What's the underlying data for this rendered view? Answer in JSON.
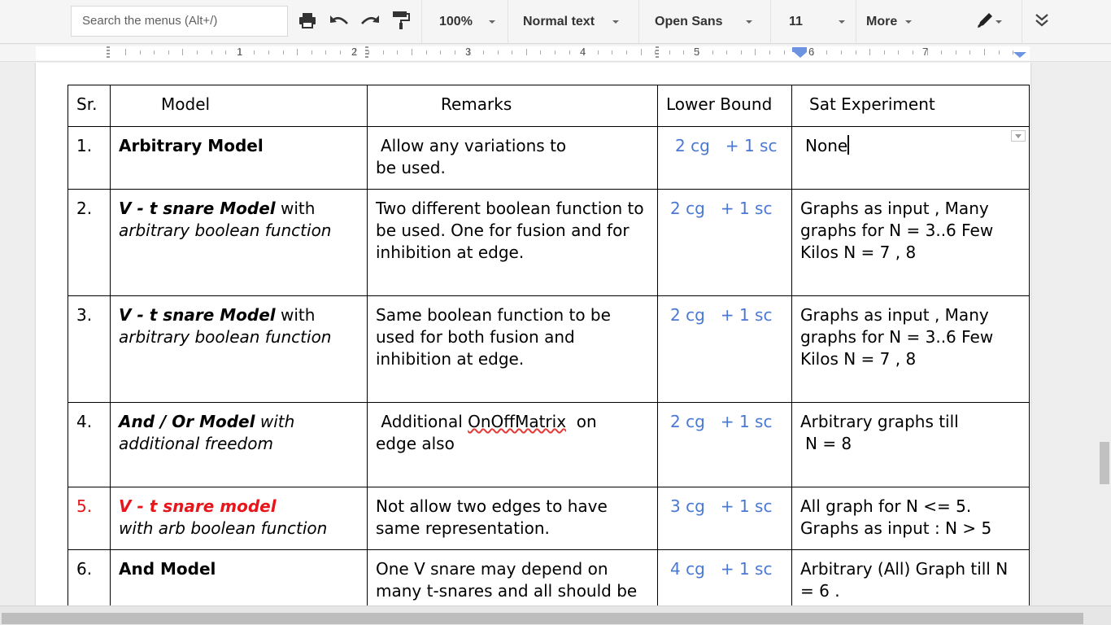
{
  "toolbar": {
    "search_placeholder": "Search the menus (Alt+/)",
    "zoom": "100%",
    "style": "Normal text",
    "font": "Open Sans",
    "size": "11",
    "more": "More"
  },
  "ruler": {
    "numbers": [
      "1",
      "2",
      "3",
      "4",
      "5",
      "6",
      "7"
    ]
  },
  "table": {
    "headers": [
      "Sr.",
      "Model",
      "Remarks",
      "Lower Bound",
      "Sat Experiment"
    ],
    "rows": [
      {
        "sr": "1.",
        "model_bold": "Arbitrary Model",
        "remarks_1": "Allow any variations to",
        "remarks_2": "be used.",
        "cg": "2 cg",
        "sc": "+ 1 sc",
        "sat": "None"
      },
      {
        "sr": "2.",
        "model_bold": "V - t snare Model",
        "model_with": " with",
        "model_2": "arbitrary boolean function",
        "remarks": "Two different boolean function to be used. One for fusion and for inhibition at edge.",
        "cg": "2 cg",
        "sc": "+ 1 sc",
        "sat": "Graphs as input , Many graphs for N = 3..6 Few Kilos N = 7 , 8"
      },
      {
        "sr": "3.",
        "model_bold": "V - t snare Model",
        "model_with": " with",
        "model_2": "arbitrary boolean function",
        "remarks": "Same boolean function  to be used for both fusion and inhibition at edge.",
        "cg": "2 cg",
        "sc": "+ 1 sc",
        "sat": "Graphs as input , Many graphs for N = 3..6 Few Kilos N = 7 , 8"
      },
      {
        "sr": "4.",
        "model_bold": "And / Or Model",
        "model_with": " with",
        "model_2": "additional freedom",
        "remarks_pre": " Additional ",
        "remarks_sq": "OnOffMatrix",
        "remarks_post": "  on",
        "remarks_2": "edge also",
        "cg": "2 cg",
        "sc": "+ 1 sc",
        "sat_1": "Arbitrary graphs till",
        "sat_2": "N = 8"
      },
      {
        "sr": "5.",
        "model_bold": "V - t snare model",
        "model_2": "with arb boolean function",
        "remarks": "Not allow two edges to have same representation.",
        "cg": "3 cg",
        "sc": "+ 1 sc",
        "sat": "All graph for N <= 5. Graphs as input : N > 5"
      },
      {
        "sr": "6.",
        "model_bold": "And Model",
        "remarks": "One V snare may depend on many t-snares and all should be",
        "cg": "4 cg",
        "sc": "+ 1 sc",
        "sat": "Arbitrary (All) Graph till N = 6 ."
      }
    ]
  },
  "colors": {
    "blue_text": "#4a78d4",
    "red_text": "#e8161b"
  },
  "icons": [
    "print-icon",
    "undo-icon",
    "redo-icon",
    "paint-format-icon",
    "pen-icon",
    "collapse-icon"
  ]
}
